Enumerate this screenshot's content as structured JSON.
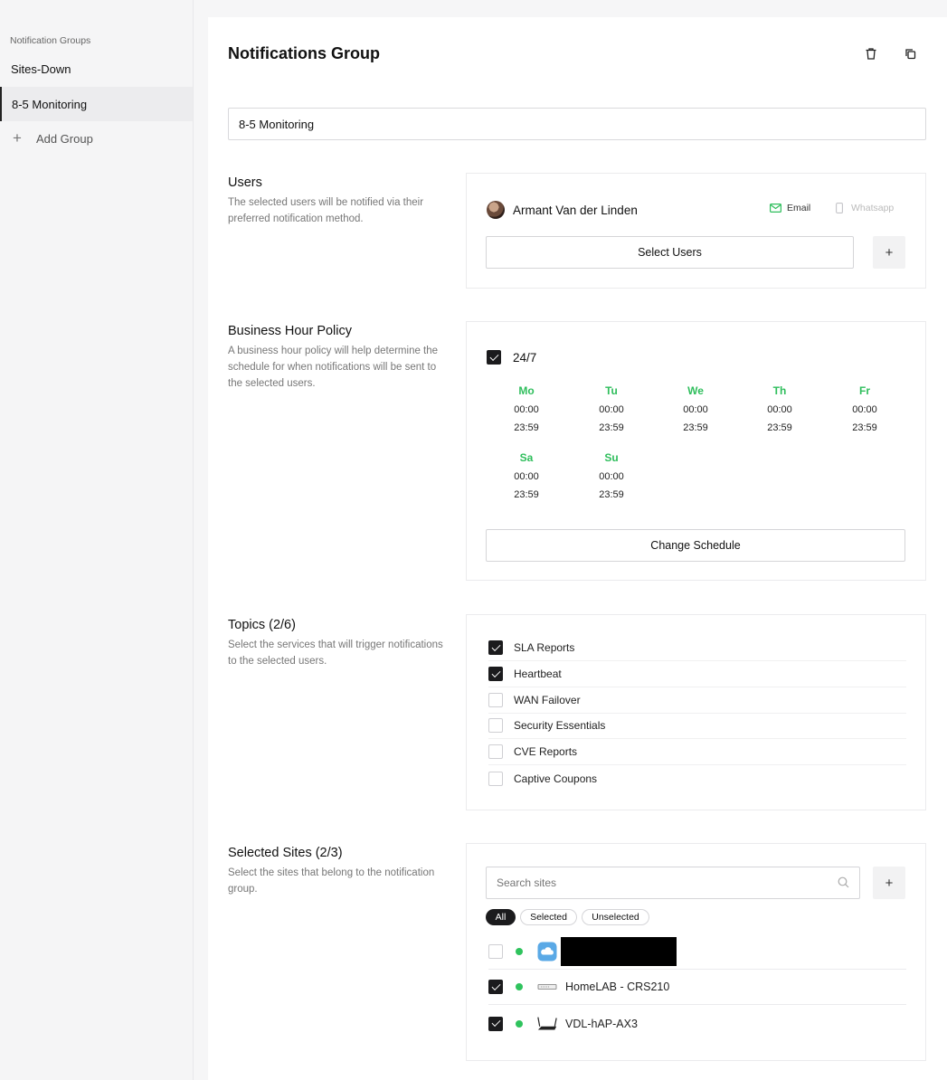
{
  "sidebar": {
    "heading": "Notification Groups",
    "items": [
      {
        "label": "Sites-Down"
      },
      {
        "label": "8-5 Monitoring"
      }
    ],
    "add_label": "Add Group",
    "add_icon": "plus-icon"
  },
  "header": {
    "title": "Notifications Group",
    "icons": [
      "trash-icon",
      "copy-icon"
    ]
  },
  "group_name": {
    "value": "8-5 Monitoring"
  },
  "users": {
    "title": "Users",
    "description": "The selected users will be notified via their preferred notification method.",
    "list": [
      {
        "name": "Armant Van der Linden",
        "methods": [
          {
            "label": "Email",
            "enabled": true
          },
          {
            "label": "Whatsapp",
            "enabled": false
          }
        ]
      }
    ],
    "select_label": "Select Users",
    "add_icon": "+"
  },
  "business_hours": {
    "title": "Business Hour Policy",
    "description": "A business hour policy will help determine the schedule for when notifications will be sent to the selected users.",
    "always_label": "24/7",
    "always_checked": true,
    "days": [
      {
        "label": "Mo",
        "start": "00:00",
        "end": "23:59"
      },
      {
        "label": "Tu",
        "start": "00:00",
        "end": "23:59"
      },
      {
        "label": "We",
        "start": "00:00",
        "end": "23:59"
      },
      {
        "label": "Th",
        "start": "00:00",
        "end": "23:59"
      },
      {
        "label": "Fr",
        "start": "00:00",
        "end": "23:59"
      },
      {
        "label": "Sa",
        "start": "00:00",
        "end": "23:59"
      },
      {
        "label": "Su",
        "start": "00:00",
        "end": "23:59"
      }
    ],
    "change_label": "Change Schedule",
    "day_color": "#2fbe5c"
  },
  "topics": {
    "title": "Topics (2/6)",
    "description": "Select the services that will trigger notifications to the selected users.",
    "items": [
      {
        "label": "SLA Reports",
        "checked": true
      },
      {
        "label": "Heartbeat",
        "checked": true
      },
      {
        "label": "WAN Failover",
        "checked": false
      },
      {
        "label": "Security Essentials",
        "checked": false
      },
      {
        "label": "CVE Reports",
        "checked": false
      },
      {
        "label": "Captive Coupons",
        "checked": false
      }
    ]
  },
  "sites": {
    "title": "Selected Sites (2/3)",
    "description": "Select the sites that belong to the notification group.",
    "search_placeholder": "Search sites",
    "add_icon": "+",
    "filters": [
      {
        "label": "All",
        "active": true
      },
      {
        "label": "Selected",
        "active": false
      },
      {
        "label": "Unselected",
        "active": false
      }
    ],
    "items": [
      {
        "name": "",
        "checked": false,
        "status": "online",
        "icon": "cloud-icon",
        "redacted": true
      },
      {
        "name": "HomeLAB - CRS210",
        "checked": true,
        "status": "online",
        "icon": "switch-icon"
      },
      {
        "name": "VDL-hAP-AX3",
        "checked": true,
        "status": "online",
        "icon": "router-icon"
      }
    ],
    "status_color": "#2fc35d"
  }
}
